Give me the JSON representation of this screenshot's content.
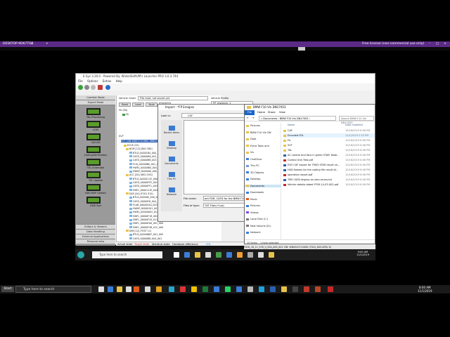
{
  "host": {
    "tab_title": "DESKTOP-9D67TD3",
    "tab_close": "×",
    "new_tab": "+",
    "license_text": "Free license (non-commercial use only)",
    "controls": [
      "–",
      "□",
      "×"
    ]
  },
  "esys": {
    "title": "E-Sys 3.30.0 - Powered By: WinkelSoftUM's Launcher PRO 3.0.3.744",
    "menu": [
      "File",
      "Options",
      "Extras",
      "Help"
    ],
    "nav_header": "Comfort Mode",
    "nav_sub": "Expert Mode",
    "nav_items": [
      "TAL-Processing",
      "VCM",
      "CAF/SD",
      "Coding/Verification",
      "TSL-Extended",
      "TSL Update",
      "NAV-MAP Update",
      "SWE-Tool"
    ],
    "nav_bottom": [
      "Editors & Viewers",
      "Data Handling",
      "External Applications",
      "Personal view"
    ],
    "vehicle_order_label": "Vehicle Order",
    "vehicle_order_value": "File read, not saved yet",
    "buttons": [
      "Read",
      "Load",
      "Save",
      "Edit"
    ],
    "vehicle_profile_label": "Vehicle Profile",
    "vehicle_profile_value": "FP_Instance_1",
    "fa_label": "FA (FA)",
    "fa_sub": "FA",
    "svt_label": "SVT",
    "tree_root": "SVT (VIN:WBA7C41080) (WBA)",
    "tree_items": [
      "ECUS (32)",
      "BCM [12] [BA1 F60]",
      "BTLD_00001B4_000_016",
      "CAFD_00000BA_001_005",
      "CAFD_00000BB_003_002",
      "FLSL_00000B0_001_001",
      "HWEL_00000B4_004_000",
      "HWAP_0000000_000_000",
      "ACC [20] (I6S1 D51)",
      "BTLD_0000111E_000_000",
      "CAFD_00000FFE_001_000",
      "CAFD_00000FF1_003_000",
      "SWFL_0000111E_004_000",
      "DAS [44] (F101 S10)",
      "BTLD_00000E_000_001_000",
      "CAFD_00000F6_004_006",
      "FLAB_00000010_003_000",
      "HWAP_00000101_003_000",
      "HWEL_00000001_012_000",
      "SWFL_00000F18_002_002",
      "SWFL_00000F20_011_000",
      "SWFL_00000FA0_001_000",
      "SWFL_00000F48_012_000",
      "DIM [12] (TEST 11)",
      "BTLD_00000B87_001_005",
      "CAFD_00000B8_004_001"
    ],
    "status_actual": "Actual state",
    "status_target": "Target state",
    "status_identical": "Identical state",
    "status_diff": "Hardware difference",
    "status_vol": "VOL",
    "infobar": "F010_16_11_530_V_004_000_001  VIN: WBA5A7C41080 (F010_DAS-WFA/ 0)"
  },
  "dialog": {
    "title": "Import - *FP Ereignis",
    "look_in_label": "Look in:",
    "look_in_value": "CAF",
    "places": [
      "Recent Items",
      "Desktop",
      "Documents",
      "This PC",
      "Network"
    ],
    "filename_label": "File name:",
    "filename_value": "ent FDR, CAFD for the BMW F10_Ne...",
    "filetype_label": "Files of type:",
    "filetype_value": "TXT Files (*.txt)",
    "save_button": "Save"
  },
  "explorer": {
    "title": "BMW F10 Vin DN17053",
    "tabs": [
      "File",
      "Home",
      "Share",
      "View"
    ],
    "path": "« Documents › BMW F10 Vin DN17053 ›",
    "search_placeholder": "Search BMW F10 Vin DN17053",
    "nav_items": [
      "Pictures",
      "BMW F10 Vin DN",
      "Data",
      "Extra Tools and",
      "Vis",
      "OneDrive",
      "This PC",
      "3D Objects",
      "Desktop",
      "Documents",
      "Downloads",
      "Music",
      "Pictures",
      "Videos",
      "Local Disk (C:)",
      "New Volume (D:)",
      "Network"
    ],
    "col_name": "Name",
    "col_date": "Date modified",
    "files": [
      {
        "name": "CAF",
        "date": "10/16/2019 8:56 PM",
        "kind": "folder"
      },
      {
        "name": "Encoded FDL",
        "date": "11/1/2019 2:53 PM",
        "kind": "folder"
      },
      {
        "name": "FA",
        "date": "10/16/2019 8:56 PM",
        "kind": "folder"
      },
      {
        "name": "SVT",
        "date": "10/16/2019 8:56 PM",
        "kind": "folder"
      },
      {
        "name": "TAL",
        "date": "10/16/2019 8:56 PM",
        "kind": "folder"
      },
      {
        "name": "AC control and fans in green STAR. Note...",
        "date": "10/16/2019 8:56 PM",
        "kind": "doc"
      },
      {
        "name": "Control Unit Tree.pdf",
        "date": "10/16/2019 8:56 PM",
        "kind": "pdf"
      },
      {
        "name": "EVO CAF export for TMS3 STAR result va...",
        "date": "10/16/2019 8:56 PM",
        "kind": "doc"
      },
      {
        "name": "HUD Names for the coding file result of...",
        "date": "10/16/2019 8:56 PM",
        "kind": "doc"
      },
      {
        "name": "operation report.pdf",
        "date": "10/16/2019 8:56 PM",
        "kind": "pdf"
      },
      {
        "name": "TMS CAFD display on zero errors.txt",
        "date": "10/16/2019 8:56 PM",
        "kind": "doc"
      },
      {
        "name": "Vehicle details dated FF09-14-03-002.pdf",
        "date": "10/16/2019 8:56 PM",
        "kind": "pdf"
      }
    ],
    "status_items": "12 items",
    "status_selected": "1 item selected",
    "date_created": "Date created: 10/16/2019 8:56 PM"
  },
  "remote_taskbar": {
    "search_placeholder": "Type here to search",
    "time": "9:00 AM",
    "date": "11/1/2019"
  },
  "host_taskbar": {
    "start": "Start",
    "search_placeholder": "Type here to search",
    "time": "8:00 AM",
    "date": "11/1/2019"
  }
}
